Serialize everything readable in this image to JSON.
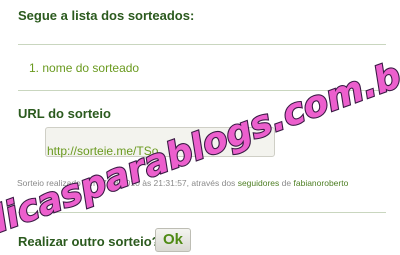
{
  "list": {
    "title": "Segue a lista dos sorteados:",
    "items": [
      {
        "number": "1.",
        "text": "nome do sorteado"
      }
    ]
  },
  "url": {
    "title": "URL do sorteio",
    "value": "http://sorteie.me/TSo"
  },
  "footer": {
    "text": "Sorteio realizado em 27/08/2010 às 21:31:57, através dos",
    "link_followers": "seguidores",
    "connector": "de",
    "link_user": "fabianoroberto"
  },
  "again": {
    "label": "Realizar outro sorteio?",
    "ok_label": "Ok"
  },
  "watermark": {
    "text": "dicasparablogs.com.br"
  }
}
